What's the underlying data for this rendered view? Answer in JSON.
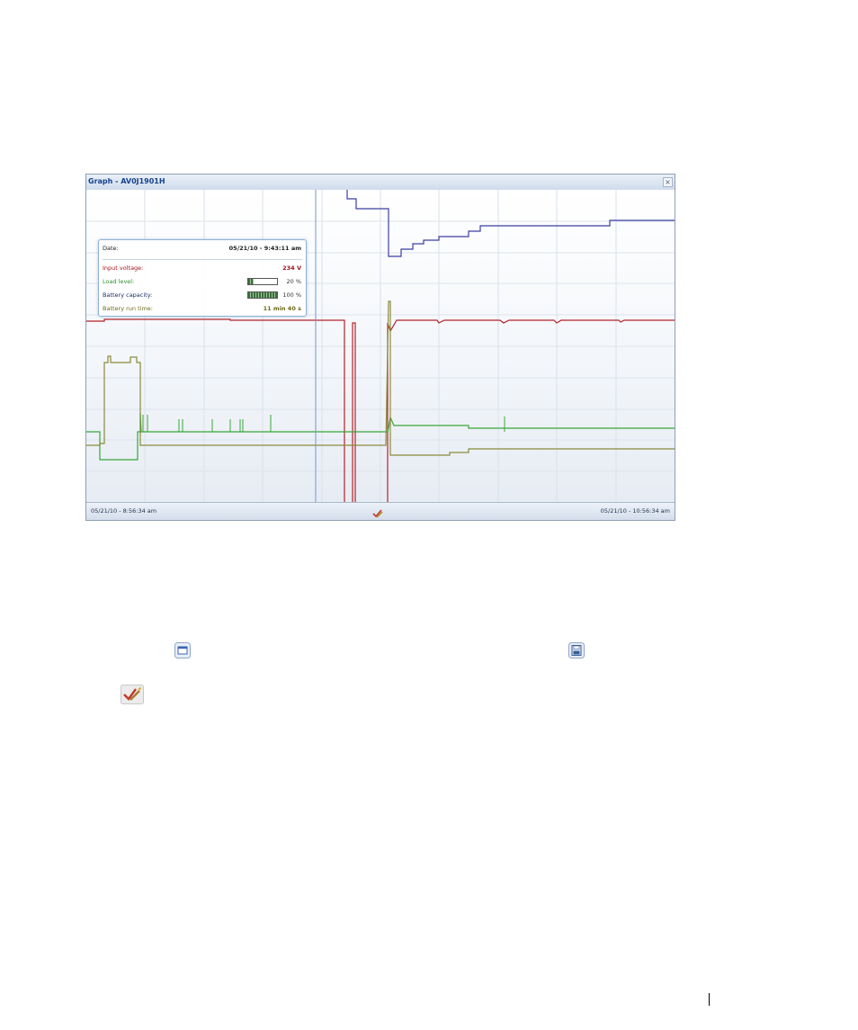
{
  "window": {
    "title": "Graph - AV0J1901H",
    "close_glyph": "×"
  },
  "tooltip": {
    "date_label": "Date:",
    "date_value": "05/21/10 - 9:43:11 am",
    "input_voltage_label": "Input voltage:",
    "input_voltage_value": "234 V",
    "load_level_label": "Load level:",
    "load_level_value": "20 %",
    "load_level_fraction": 0.2,
    "battery_capacity_label": "Battery capacity:",
    "battery_capacity_value": "100 %",
    "battery_capacity_fraction": 1.0,
    "battery_runtime_label": "Battery run time:",
    "battery_runtime_value": "11 min 40 s"
  },
  "footer": {
    "start_time": "05/21/10 - 8:56:34 am",
    "end_time": "05/21/10 - 10:56:34 am",
    "options_icon": "chart-options-icon"
  },
  "icons": {
    "maximize": "maximize-icon",
    "save": "save-icon",
    "chart_options": "chart-options-icon"
  },
  "colors": {
    "input_voltage": "#b3222a",
    "load_level": "#3aa63a",
    "battery_capacity": "#3b3fa0",
    "battery_runtime": "#8a8a3c",
    "cursor": "#6f96d6",
    "title": "#15428b"
  },
  "chart_data": {
    "type": "line",
    "x_range": [
      "05/21/10 - 8:56:34 am",
      "05/21/10 - 10:56:34 am"
    ],
    "cursor_time": "05/21/10 - 9:43:11 am",
    "grid": true,
    "legend_position": "top-left",
    "series": [
      {
        "name": "Input voltage",
        "legend_value": "234 V"
      },
      {
        "name": "Load level",
        "legend_value": "20 %"
      },
      {
        "name": "Battery capacity",
        "legend_value": "100 %"
      },
      {
        "name": "Battery run time",
        "legend_value": "11 min 40 s"
      }
    ]
  }
}
